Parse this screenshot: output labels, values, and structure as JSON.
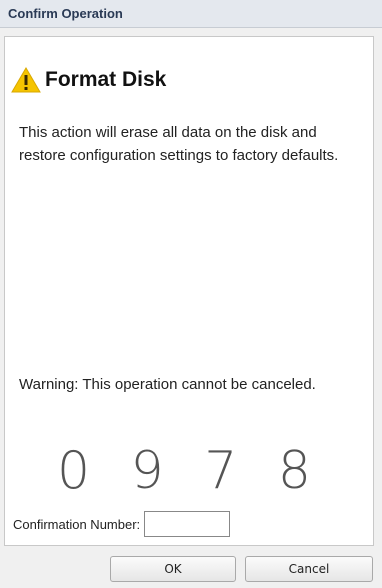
{
  "window": {
    "title": "Confirm Operation"
  },
  "dialog": {
    "heading": "Format Disk",
    "heading_icon": "warning-triangle-icon",
    "description": "This action will erase all data on the disk and restore configuration settings to factory defaults.",
    "warning": "Warning: This operation cannot be canceled.",
    "confirmation_code": "0978",
    "confirmation_label": "Confirmation Number:",
    "confirmation_value": ""
  },
  "buttons": {
    "ok_label": "OK",
    "cancel_label": "Cancel"
  },
  "colors": {
    "warning_icon": "#f5c400",
    "title_text": "#2a3a55"
  }
}
